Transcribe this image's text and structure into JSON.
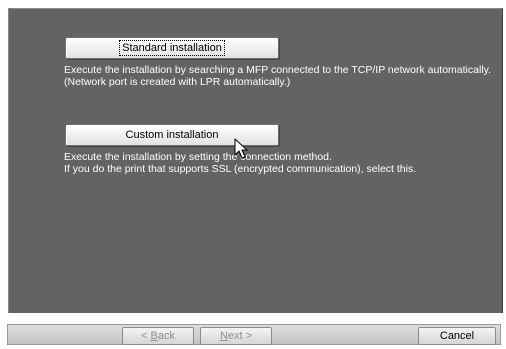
{
  "options": {
    "standard": {
      "button_label": "Standard installation",
      "description_line1": "Execute the installation by searching a MFP connected to the TCP/IP network automatically.",
      "description_line2": "(Network port is created with LPR automatically.)"
    },
    "custom": {
      "button_label": "Custom installation",
      "description_line1": "Execute the installation by setting the connection method.",
      "description_line2": "If you do the print that supports SSL (encrypted communication), select this."
    }
  },
  "footer": {
    "back_prefix": "< ",
    "back_mnemonic": "B",
    "back_rest": "ack",
    "next_mnemonic": "N",
    "next_rest": "ext >",
    "cancel_label": "Cancel"
  },
  "colors": {
    "panel_background": "#636363",
    "description_text": "#ffffff"
  },
  "icons": {
    "cursor": "mouse-pointer-icon"
  }
}
